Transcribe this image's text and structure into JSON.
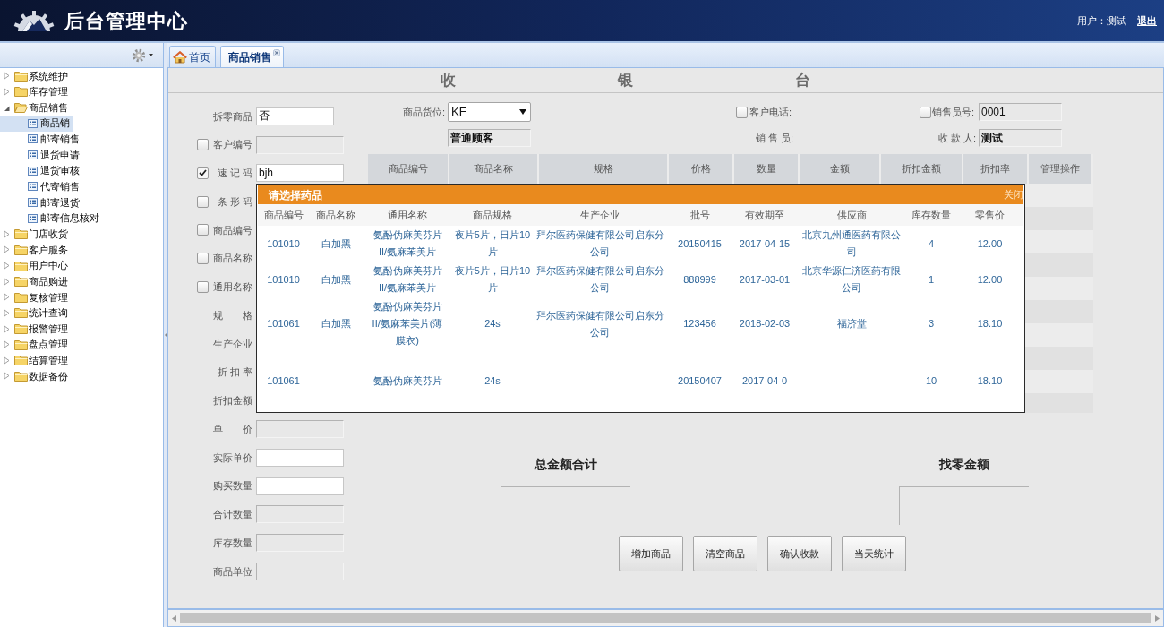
{
  "header": {
    "title": "后台管理中心",
    "user": "用户：测试",
    "logout": "退出"
  },
  "sidebar": {
    "items": [
      {
        "label": "系统维护",
        "expanded": false,
        "selected": false
      },
      {
        "label": "库存管理",
        "expanded": false,
        "selected": false
      },
      {
        "label": "商品销售",
        "expanded": true,
        "selected": false,
        "children": [
          {
            "label": "商品销",
            "selected": true
          },
          {
            "label": "邮寄销售",
            "selected": false
          },
          {
            "label": "退货申请",
            "selected": false
          },
          {
            "label": "退货审核",
            "selected": false
          },
          {
            "label": "代寄销售",
            "selected": false
          },
          {
            "label": "邮寄退货",
            "selected": false
          },
          {
            "label": "邮寄信息核对",
            "selected": false
          }
        ]
      },
      {
        "label": "门店收货",
        "expanded": false,
        "selected": false
      },
      {
        "label": "客户服务",
        "expanded": false,
        "selected": false
      },
      {
        "label": "用户中心",
        "expanded": false,
        "selected": false
      },
      {
        "label": "商品购进",
        "expanded": false,
        "selected": false
      },
      {
        "label": "复核管理",
        "expanded": false,
        "selected": false
      },
      {
        "label": "统计查询",
        "expanded": false,
        "selected": false
      },
      {
        "label": "报警管理",
        "expanded": false,
        "selected": false
      },
      {
        "label": "盘点管理",
        "expanded": false,
        "selected": false
      },
      {
        "label": "结算管理",
        "expanded": false,
        "selected": false
      },
      {
        "label": "数据备份",
        "expanded": false,
        "selected": false
      }
    ]
  },
  "tabs": [
    {
      "label": "首页",
      "kind": "home",
      "selected": false
    },
    {
      "label": "商品销售",
      "kind": "page",
      "selected": true
    }
  ],
  "cashier": {
    "title": [
      "收",
      "银",
      "台"
    ],
    "left_fields": [
      {
        "kind": "plain",
        "label": "拆零商品",
        "field": {
          "value": "否",
          "disabled": false
        }
      },
      {
        "kind": "check",
        "label": "客户编号",
        "checked": false,
        "field": {
          "disabled": true
        }
      },
      {
        "kind": "check",
        "label": "速 记 码",
        "checked": true,
        "field": {
          "value": "bjh",
          "disabled": false
        }
      },
      {
        "kind": "check",
        "label": "条 形 码",
        "checked": false
      },
      {
        "kind": "check",
        "label": "商品编号",
        "checked": false
      },
      {
        "kind": "check",
        "label": "商品名称",
        "checked": false
      },
      {
        "kind": "check",
        "label": "通用名称",
        "checked": false
      },
      {
        "kind": "plain",
        "label": "规　　格"
      },
      {
        "kind": "plain",
        "label": "生产企业"
      },
      {
        "kind": "plain",
        "label": "折 扣 率"
      },
      {
        "kind": "plain",
        "label": "折扣金额"
      },
      {
        "kind": "plain",
        "label": "单　　价",
        "field": {
          "disabled": true
        }
      },
      {
        "kind": "plain",
        "label": "实际单价",
        "field": {
          "disabled": false
        }
      },
      {
        "kind": "plain",
        "label": "购买数量",
        "field": {
          "disabled": false
        }
      },
      {
        "kind": "plain",
        "label": "合计数量",
        "field": {
          "disabled": true
        }
      },
      {
        "kind": "plain",
        "label": "库存数量",
        "field": {
          "disabled": true
        }
      },
      {
        "kind": "plain",
        "label": "商品单位",
        "field": {
          "disabled": true
        }
      }
    ],
    "location": {
      "label": "商品货位:",
      "value": "KF"
    },
    "customer_type": {
      "value": "普通顾客",
      "disabled": true
    },
    "customer_phone": {
      "label": "客户电话:",
      "checked": false
    },
    "salesperson_no": {
      "label": "销售员号:",
      "checked": false,
      "field": {
        "value": "0001",
        "disabled": true
      }
    },
    "salesperson": {
      "label": "销 售 员:"
    },
    "payee": {
      "label": "收 款 人:",
      "field": {
        "value": "测试",
        "disabled": true
      }
    },
    "table": {
      "columns": [
        "商品编号",
        "商品名称",
        "规格",
        "价格",
        "数量",
        "金额",
        "折扣金额",
        "折扣率",
        "管理操作"
      ]
    },
    "totals": [
      {
        "label": "总金额合计"
      },
      {
        "label": "找零金额"
      }
    ],
    "buttons": [
      "增加商品",
      "清空商品",
      "确认收款",
      "当天统计"
    ]
  },
  "popup": {
    "title": "请选择药品",
    "close": "关闭",
    "columns": [
      "商品编号",
      "商品名称",
      "通用名称",
      "商品规格",
      "生产企业",
      "批号",
      "有效期至",
      "供应商",
      "库存数量",
      "零售价"
    ],
    "rows": [
      {
        "code": "101010",
        "name": "白加黑",
        "generic_name": "氨酚伪麻美芬片II/氨麻苯美片",
        "spec": "夜片5片，日片10片",
        "manufacturer": "拜尔医药保健有限公司启东分公司",
        "batch_no": "20150415",
        "expiry": "2017-04-15",
        "supplier": "北京九州通医药有限公司",
        "stock": "4",
        "retail_price": "12.00"
      },
      {
        "code": "101010",
        "name": "白加黑",
        "generic_name": "氨酚伪麻美芬片II/氨麻苯美片",
        "spec": "夜片5片，日片10片",
        "manufacturer": "拜尔医药保健有限公司启东分公司",
        "batch_no": "888999",
        "expiry": "2017-03-01",
        "supplier": "北京华源仁济医药有限公司",
        "stock": "1",
        "retail_price": "12.00"
      },
      {
        "code": "101061",
        "name": "白加黑",
        "generic_name": "氨酚伪麻美芬片II/氨麻苯美片(薄膜衣)",
        "spec": "24s",
        "manufacturer": "拜尔医药保健有限公司启东分公司",
        "batch_no": "123456",
        "expiry": "2018-02-03",
        "supplier": "福济堂",
        "stock": "3",
        "retail_price": "18.10"
      },
      {
        "code": "101061",
        "generic_name": "氨酚伪麻美芬片",
        "spec": "24s",
        "batch_no": "20150407",
        "expiry": "2017-04-0",
        "stock": "10",
        "retail_price": "18.10"
      }
    ]
  }
}
